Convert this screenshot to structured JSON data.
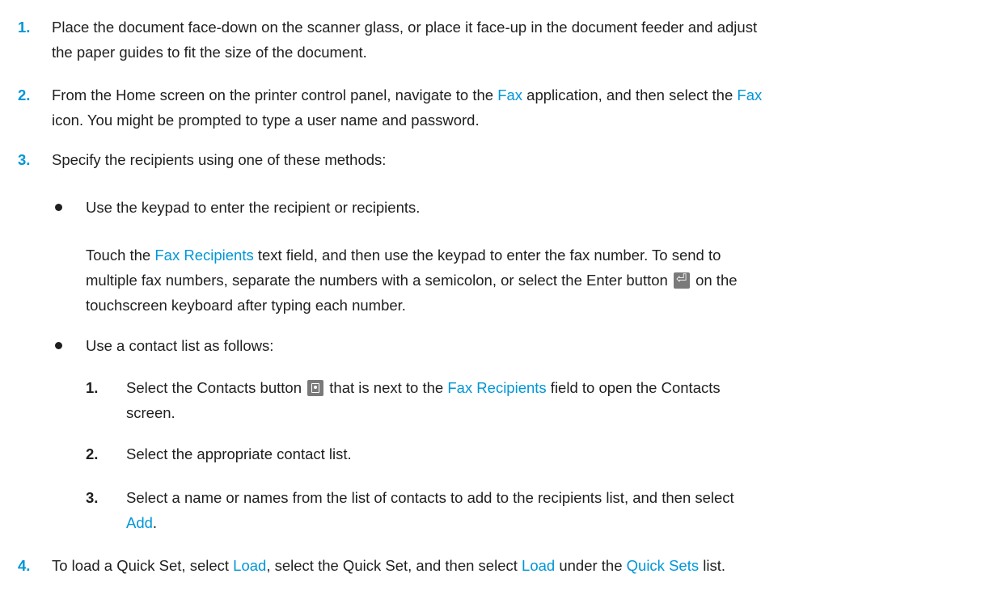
{
  "steps": [
    {
      "num": "1.",
      "lines": [
        "Place the document face-down on the scanner glass, or place it face-up in the document feeder and adjust",
        "the paper guides to fit the size of the document."
      ]
    },
    {
      "num": "2.",
      "a": "From the Home screen on the printer control panel, navigate to the ",
      "ui1": "Fax",
      "b": " application, and then select the ",
      "ui2": "Fax",
      "line2": "icon. You might be prompted to type a user name and password."
    },
    {
      "num": "3.",
      "text": "Specify the recipients using one of these methods:"
    },
    {
      "num": "4.",
      "a": "To load a Quick Set, select ",
      "ui1": "Load",
      "b": ", select the Quick Set, and then select ",
      "ui2": "Load",
      "c": " under the ",
      "ui3": "Quick Sets",
      "d": " list."
    }
  ],
  "bullets": [
    {
      "text": "Use the keypad to enter the recipient or recipients."
    },
    {
      "text": "Use a contact list as follows:"
    }
  ],
  "keypad_para": {
    "a": "Touch the ",
    "ui1": "Fax Recipients",
    "b": " text field, and then use the keypad to enter the fax number. To send to",
    "line2a": "multiple fax numbers, separate the numbers with a semicolon, or select the Enter button",
    "line2b": "on the",
    "line3": "touchscreen keyboard after typing each number."
  },
  "substeps": [
    {
      "num": "1.",
      "a": "Select the Contacts button",
      "b": "that is next to the ",
      "ui1": "Fax Recipients",
      "c": " field to open the Contacts",
      "line2": "screen."
    },
    {
      "num": "2.",
      "text": "Select the appropriate contact list."
    },
    {
      "num": "3.",
      "a": "Select a name or names from the list of contacts to add to the recipients list, and then select",
      "ui1": "Add",
      "b": "."
    }
  ],
  "icons": {
    "enter": "enter-icon",
    "contacts": "contacts-icon"
  },
  "colors": {
    "accent": "#0096d6",
    "text": "#1f1f1f",
    "icon_bg": "#7a7a7a"
  }
}
